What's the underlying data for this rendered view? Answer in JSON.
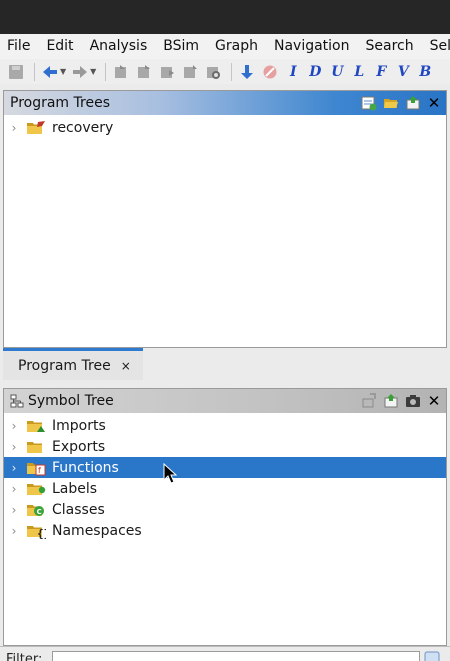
{
  "menubar": {
    "items": [
      "File",
      "Edit",
      "Analysis",
      "BSim",
      "Graph",
      "Navigation",
      "Search",
      "Sele"
    ]
  },
  "toolbar": {
    "letters": [
      "I",
      "D",
      "U",
      "L",
      "F",
      "V",
      "B"
    ]
  },
  "program_trees": {
    "title": "Program Trees",
    "items": [
      {
        "label": "recovery",
        "icon": "folder-flag-icon"
      }
    ]
  },
  "program_tree_tab": {
    "label": "Program Tree",
    "close": "×"
  },
  "symbol_tree": {
    "title": "Symbol Tree",
    "items": [
      {
        "label": "Imports",
        "icon": "folder-imports-icon",
        "selected": false
      },
      {
        "label": "Exports",
        "icon": "folder-exports-icon",
        "selected": false
      },
      {
        "label": "Functions",
        "icon": "folder-functions-icon",
        "selected": true
      },
      {
        "label": "Labels",
        "icon": "folder-labels-icon",
        "selected": false
      },
      {
        "label": "Classes",
        "icon": "folder-classes-icon",
        "selected": false
      },
      {
        "label": "Namespaces",
        "icon": "folder-namespaces-icon",
        "selected": false
      }
    ]
  },
  "filter": {
    "label": "Filter:",
    "value": ""
  },
  "colors": {
    "selection": "#2a77c9",
    "folder": "#e8c24a",
    "accent_blue": "#2047c0"
  }
}
